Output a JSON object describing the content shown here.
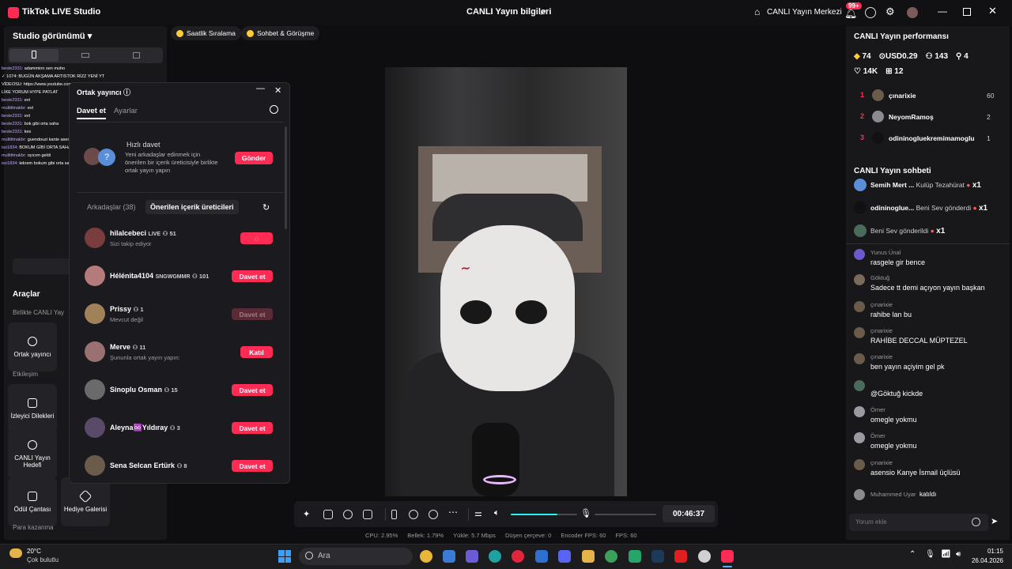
{
  "titlebar": {
    "app_title": "TikTok LIVE Studio",
    "live_info": "CANLI Yayın bilgileri",
    "live_center": "CANLI Yayın Merkezi",
    "notif_badge": "99+"
  },
  "left": {
    "studio_view": "Studio görünümü",
    "chat_preview": [
      {
        "user": "beste2331:",
        "text": "adamminn sen muho"
      },
      {
        "user": "",
        "text": "✓ 1074: BUGÜN AKŞAMA ARTISTOK RİZZ YENİ YT"
      },
      {
        "user": "",
        "text": "VİDEOSU: https://www.youtube.com/watch?v=3whs39cYMr0"
      },
      {
        "user": "",
        "text": "LİKE YORUM HYPE PATLAT"
      },
      {
        "user": "beste2331:",
        "text": "evt"
      },
      {
        "user": "multititnakbr:",
        "text": "evt"
      },
      {
        "user": "beste2331:",
        "text": "evt"
      },
      {
        "user": "beste2331:",
        "text": "bok gibi orta saha"
      },
      {
        "user": "beste2331:",
        "text": "kes"
      },
      {
        "user": "multititnakbr:",
        "text": "guendouzi kante asensio İsmail gitten giricek"
      },
      {
        "user": "iso1834:",
        "text": "BOKUM GİBİ ORTA SAHA BU ARADA @bakespek"
      },
      {
        "user": "multititnakbr:",
        "text": "oyıcım geldi"
      },
      {
        "user": "iso1834:",
        "text": "tekrem bokum gibi orta saha bu arada"
      }
    ],
    "tools_title": "Araçlar",
    "section_cohost": "Birlikte CANLI Yay",
    "section_interaction": "Etkileşim",
    "section_earn": "Para kazanma",
    "tools": [
      {
        "label": "Ortak yayıncı",
        "icon": "link-icon"
      },
      {
        "label": "İzleyici Dilekleri",
        "icon": "users-icon"
      },
      {
        "label": "CANLI Yayın Hedefi",
        "icon": "target-icon"
      },
      {
        "label": "Ödül Çantası",
        "icon": "bag-icon"
      },
      {
        "label": "Hediye Galerisi",
        "icon": "gift-icon"
      }
    ]
  },
  "pills": [
    "Saatlik Sıralama",
    "Sohbet & Görüşme"
  ],
  "cohost": {
    "title": "Ortak yayıncı",
    "tab_invite": "Davet et",
    "tab_settings": "Ayarlar",
    "quick_invite": "Hızlı davet",
    "quick_desc": "Yeni arkadaşlar edinmek için önerilen bir içerik üreticisiyle birlikte ortak yayın yapın",
    "send": "Gönder",
    "friends_tab": "Arkadaşlar (38)",
    "suggested_tab": "Önerilen içerik üreticileri",
    "rows": [
      {
        "name": "hilalcebeci",
        "tag": "LIVE",
        "count": "51",
        "sub": "Sizi takip ediyor",
        "action": "",
        "state": "loading"
      },
      {
        "name": "Hélénita4104",
        "tag": "SNGWGMMR",
        "count": "101",
        "sub": "",
        "action": "Davet et",
        "state": "active"
      },
      {
        "name": "Prissy",
        "tag": "",
        "count": "1",
        "sub": "Mevcut değil",
        "action": "Davet et",
        "state": "disabled"
      },
      {
        "name": "Merve",
        "tag": "",
        "count": "11",
        "sub": "Şununla ortak yayın yapın:",
        "action": "Katıl",
        "state": "active"
      },
      {
        "name": "Sinoplu Osman",
        "tag": "",
        "count": "15",
        "sub": "",
        "action": "Davet et",
        "state": "active"
      },
      {
        "name": "Aleyna♾️Yıldıray",
        "tag": "",
        "count": "3",
        "sub": "",
        "action": "Davet et",
        "state": "active"
      },
      {
        "name": "Sena Selcan Ertürk",
        "tag": "",
        "count": "8",
        "sub": "",
        "action": "Davet et",
        "state": "active"
      }
    ]
  },
  "controls": {
    "timer": "00:46:37",
    "volume_level": 0.7
  },
  "stats": {
    "cpu": "CPU:  2.95%",
    "mem": "Bellek:  1.79%",
    "upload": "Yükle:  5.7 Mbps",
    "dropped": "Düşen çerçeve:  0",
    "encoder": "Encoder FPS:  60",
    "fps": "FPS:  60"
  },
  "right": {
    "perf_title": "CANLI Yayın performansı",
    "metrics": {
      "diamonds": "74",
      "usd": "USD0.29",
      "viewers": "143",
      "new": "4",
      "likes": "14K",
      "gifts": "12"
    },
    "ranking": [
      {
        "rank": "1",
        "name": "çınarixie",
        "value": "60"
      },
      {
        "rank": "2",
        "name": "NeyomRamoş",
        "value": "2"
      },
      {
        "rank": "3",
        "name": "odininogluekremimamoglu",
        "value": "1"
      }
    ],
    "chat_title": "CANLI Yayın sohbeti",
    "gift_events": [
      {
        "name": "Semih Mert ...",
        "text": "Kulüp Tezahürat",
        "count": "x1"
      },
      {
        "name": "odininoglue...",
        "text": "Beni Sev gönderdi",
        "count": "x1"
      },
      {
        "name": "",
        "text": "Beni Sev gönderildi",
        "count": "x1"
      }
    ],
    "comments": [
      {
        "user": "Yunus Ünal",
        "text": "rasgele gir bence"
      },
      {
        "user": "Göktuğ",
        "text": "Sadece tt demi açıyon yayın başkan"
      },
      {
        "user": "çınarixie",
        "text": "rahibe lan bu"
      },
      {
        "user": "çınarixie",
        "text": "RAHİBE DECCAL MÜPTEZEL"
      },
      {
        "user": "çınarixie",
        "text": "ben yayın açiyim gel pk"
      },
      {
        "user": "",
        "text": "@Göktuğ kickde"
      },
      {
        "user": "Ömer",
        "text": "omegle yokmu"
      },
      {
        "user": "Ömer",
        "text": "omegle yokmu"
      },
      {
        "user": "çınarixie",
        "text": "asensio Kanye İsmail üçlüsü"
      }
    ],
    "joined_user": "Muhammed Uyar",
    "joined_text": "katıldı",
    "comment_placeholder": "Yorum ekle"
  },
  "taskbar": {
    "weather_temp": "20°C",
    "weather_desc": "Çok bulutlu",
    "search": "Ara",
    "time": "01:15",
    "date": "26.04.2026"
  }
}
